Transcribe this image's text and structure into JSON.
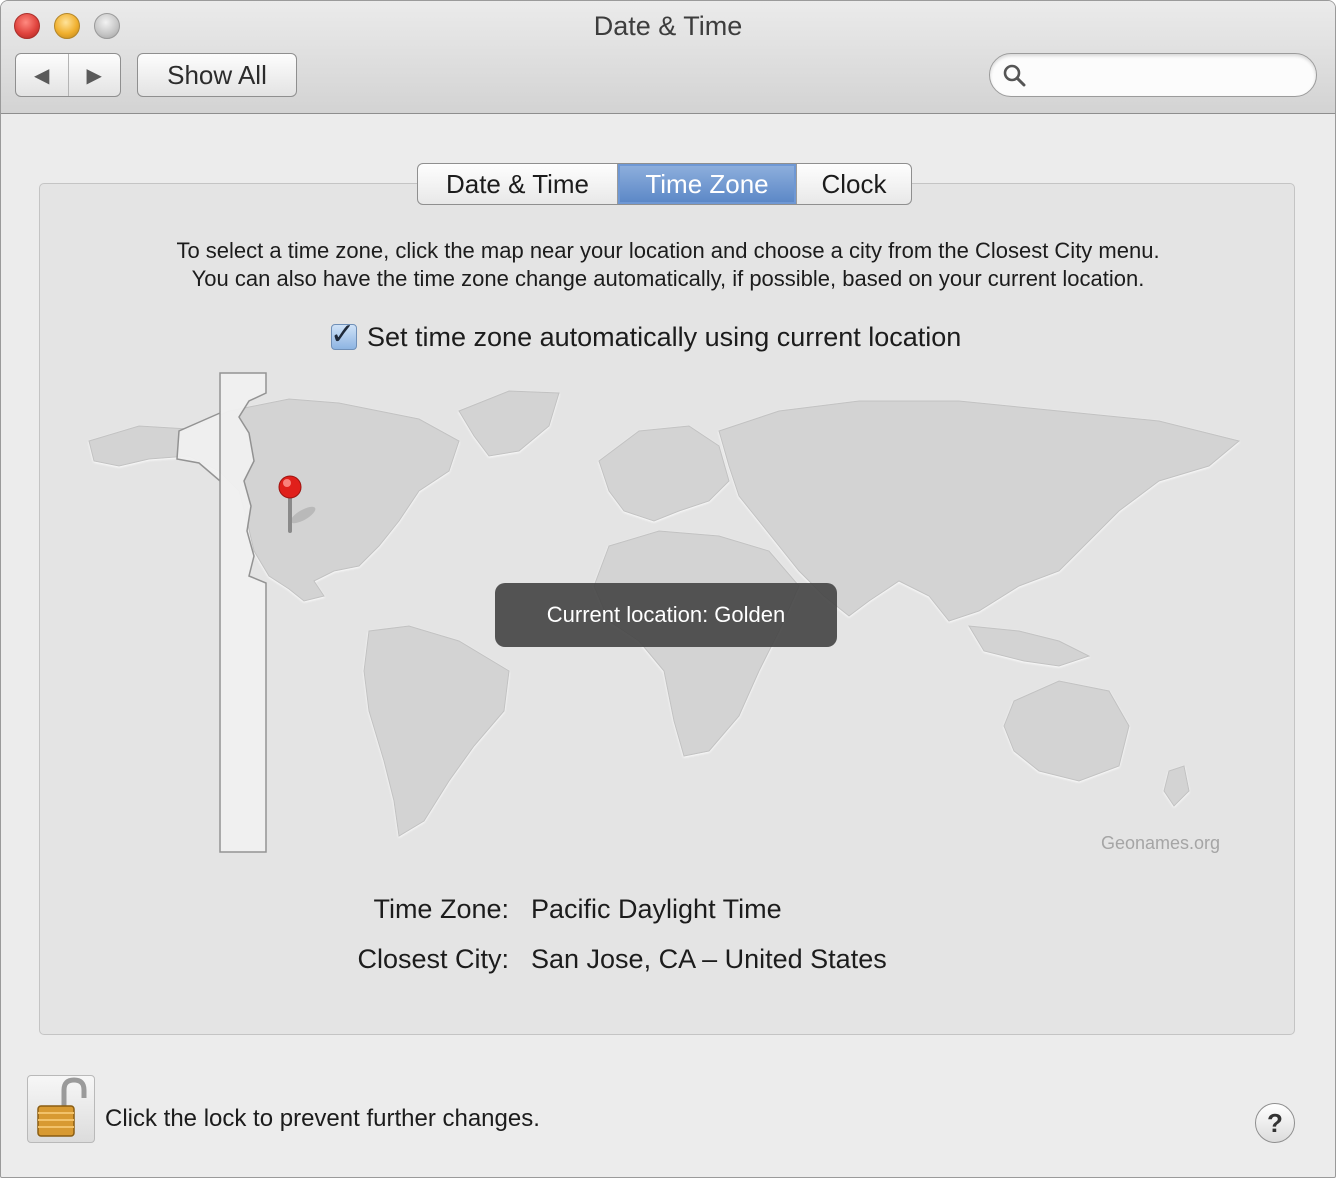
{
  "window": {
    "title": "Date & Time"
  },
  "toolbar": {
    "back_glyph": "◀",
    "forward_glyph": "▶",
    "show_all_label": "Show All",
    "search_placeholder": "",
    "search_value": ""
  },
  "tabs": [
    {
      "label": "Date & Time",
      "selected": false
    },
    {
      "label": "Time Zone",
      "selected": true
    },
    {
      "label": "Clock",
      "selected": false
    }
  ],
  "time_zone_pane": {
    "instructions_line1": "To select a time zone, click the map near your location and choose a city from the Closest City menu.",
    "instructions_line2": "You can also have the time zone change automatically, if possible, based on your current location.",
    "auto_checkbox": {
      "label": "Set time zone automatically using current location",
      "checked": true
    },
    "map_tooltip": "Current location: Golden",
    "map_credit": "Geonames.org",
    "time_zone_label": "Time Zone:",
    "time_zone_value": "Pacific Daylight Time",
    "closest_city_label": "Closest City:",
    "closest_city_value": "San Jose, CA – United States"
  },
  "footer": {
    "lock_text": "Click the lock to prevent further changes.",
    "help_glyph": "?"
  },
  "colors": {
    "selected_tab": "#6f98d4",
    "pin": "#e0201b",
    "map_land": "#d3d3d3",
    "tooltip_bg": "#464646"
  },
  "icons": {
    "search": "magnifier-icon",
    "lock": "open-padlock-icon",
    "pin": "map-pin-icon",
    "help": "question-mark-icon"
  }
}
